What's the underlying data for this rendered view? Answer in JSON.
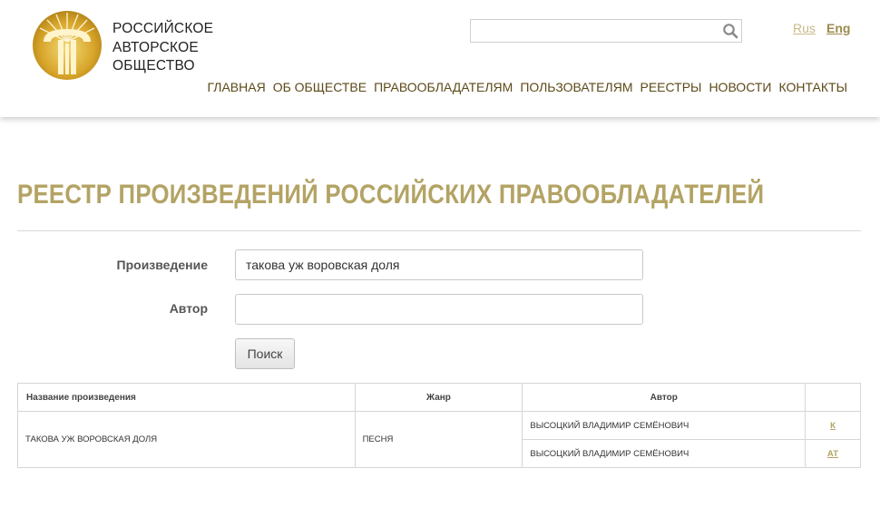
{
  "brand": {
    "line1": "РОССИЙСКОЕ",
    "line2": "АВТОРСКОЕ",
    "line3": "ОБЩЕСТВО",
    "logo_icon": "rao-logo-icon",
    "gold": "#b3a364"
  },
  "header": {
    "search_placeholder": "",
    "search_icon": "search-icon",
    "lang_rus": "Rus",
    "lang_eng": "Eng"
  },
  "nav": [
    {
      "label": "ГЛАВНАЯ"
    },
    {
      "label": "ОБ ОБЩЕСТВЕ"
    },
    {
      "label": "ПРАВООБЛАДАТЕЛЯМ"
    },
    {
      "label": "ПОЛЬЗОВАТЕЛЯМ"
    },
    {
      "label": "РЕЕСТРЫ"
    },
    {
      "label": "НОВОСТИ"
    },
    {
      "label": "КОНТАКТЫ"
    }
  ],
  "page": {
    "title": "РЕЕСТР ПРОИЗВЕДЕНИЙ РОССИЙСКИХ ПРАВООБЛАДАТЕЛЕЙ"
  },
  "form": {
    "work_label": "Произведение",
    "work_value": "такова уж воровская доля",
    "author_label": "Автор",
    "author_value": "",
    "search_button": "Поиск"
  },
  "table": {
    "headers": [
      "Название произведения",
      "Жанр",
      "Автор",
      ""
    ],
    "rows": [
      {
        "title": "такова уж воровская доля",
        "genre": "песня",
        "authors": [
          {
            "name": "высоцкий владимир семёнович",
            "code": "К"
          },
          {
            "name": "высоцкий владимир семёнович",
            "code": "АТ"
          }
        ]
      }
    ]
  }
}
